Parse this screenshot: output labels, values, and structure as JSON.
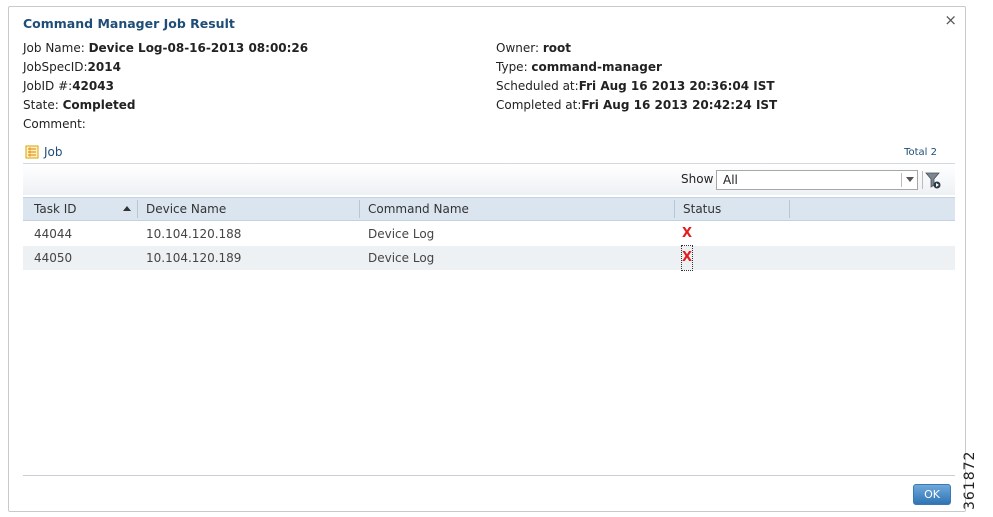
{
  "dialog": {
    "title": "Command Manager Job Result",
    "close_label": "×"
  },
  "job_info": {
    "job_name_label": "Job Name: ",
    "job_name": "Device Log-08-16-2013 08:00:26",
    "jobspec_label": "JobSpecID:",
    "jobspec": "2014",
    "jobid_label": "JobID #:",
    "jobid": "42043",
    "state_label": "State: ",
    "state": "Completed",
    "comment_label": "Comment:",
    "owner_label": "Owner: ",
    "owner": "root",
    "type_label": "Type: ",
    "type": "command-manager",
    "scheduled_label": "Scheduled at:",
    "scheduled": "Fri Aug 16 2013 20:36:04 IST",
    "completed_label": "Completed at:",
    "completed": "Fri Aug 16 2013 20:42:24 IST"
  },
  "job_tab": {
    "label": "Job",
    "icon": "job-list-icon"
  },
  "total_label": "Total 2",
  "filter": {
    "show_label": "Show",
    "selected": "All",
    "icon": "filter-icon"
  },
  "table": {
    "headers": [
      "Task ID",
      "Device Name",
      "Command Name",
      "Status"
    ],
    "rows": [
      {
        "task_id": "44044",
        "device": "10.104.120.188",
        "command": "Device Log",
        "status": "X"
      },
      {
        "task_id": "44050",
        "device": "10.104.120.189",
        "command": "Device Log",
        "status": "X"
      }
    ]
  },
  "footer": {
    "ok_label": "OK"
  },
  "figure_id": "361872",
  "colors": {
    "title": "#1f4d77",
    "header_bg": "#dbe5ef",
    "error": "#e02020",
    "ok_button": "#2f74b5"
  }
}
